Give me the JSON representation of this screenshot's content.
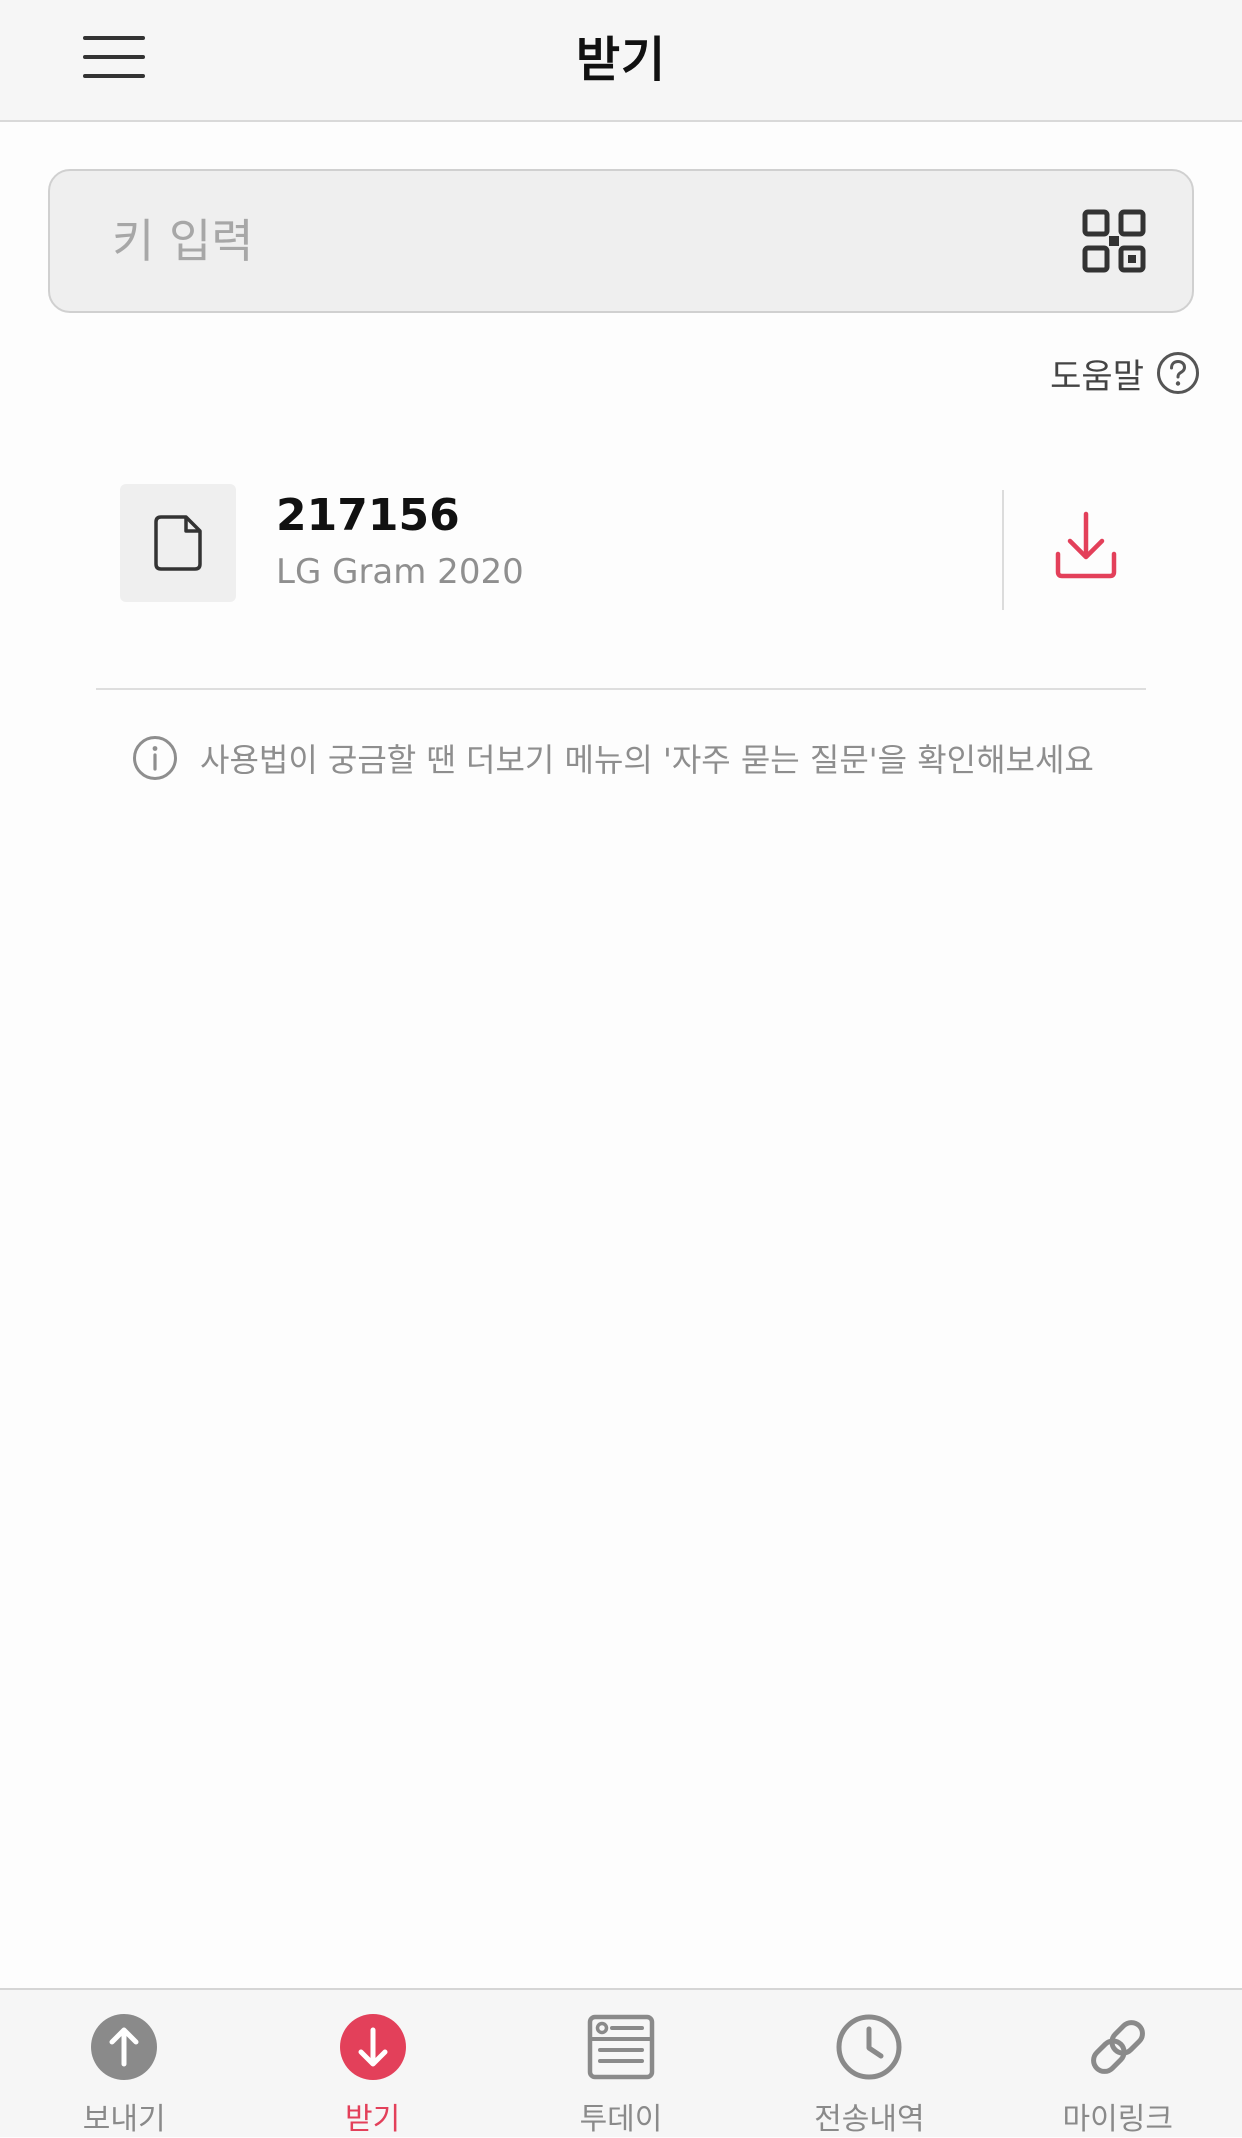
{
  "header": {
    "title": "받기",
    "menu_icon": "hamburger-menu-icon"
  },
  "key_input": {
    "placeholder": "키 입력",
    "value": "",
    "qr_icon": "qr-code-icon"
  },
  "help": {
    "label": "도움말",
    "icon": "question-circle-icon"
  },
  "received_item": {
    "key": "217156",
    "device": "LG Gram 2020",
    "file_icon": "file-icon",
    "download_icon": "download-icon"
  },
  "tip": {
    "icon": "info-circle-icon",
    "text": "사용법이 궁금할 땐 더보기 메뉴의 '자주 묻는 질문'을 확인해보세요"
  },
  "tabbar": {
    "active_index": 1,
    "tabs": [
      {
        "label": "보내기",
        "icon": "upload-arrow-icon"
      },
      {
        "label": "받기",
        "icon": "download-arrow-icon"
      },
      {
        "label": "투데이",
        "icon": "today-card-icon"
      },
      {
        "label": "전송내역",
        "icon": "clock-icon"
      },
      {
        "label": "마이링크",
        "icon": "link-icon"
      }
    ]
  },
  "colors": {
    "accent": "#e3405a",
    "inactive": "#8a8a8a",
    "header_bg": "#f6f6f6"
  }
}
